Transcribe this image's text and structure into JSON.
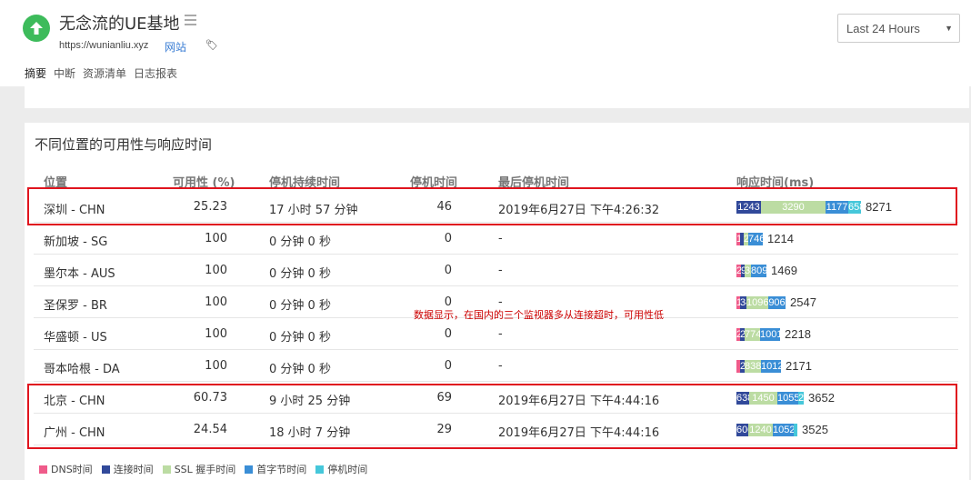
{
  "header": {
    "title": "无念流的UE基地",
    "url": "https://wunianliu.xyz",
    "type_label": "网站",
    "time_range": "Last 24 Hours"
  },
  "tabs": [
    {
      "label": "摘要",
      "active": true
    },
    {
      "label": "中断",
      "active": false
    },
    {
      "label": "资源清单",
      "active": false
    },
    {
      "label": "日志报表",
      "active": false
    }
  ],
  "section": {
    "title": "不同位置的可用性与响应时间",
    "columns": [
      "位置",
      "可用性 (%)",
      "停机持续时间",
      "停机时间",
      "最后停机时间",
      "响应时间(ms)"
    ]
  },
  "colors": {
    "dns": "#ef5b8a",
    "connect": "#31499a",
    "ssl": "#bcdca3",
    "first_byte": "#3a8ed6",
    "down": "#45c7da"
  },
  "rows": [
    {
      "location": "深圳 - CHN",
      "availability": "25.23",
      "downtime_duration": "17 小时 57 分钟",
      "downtime_count": "46",
      "last_down": "2019年6月27日 下午4:26:32",
      "segments": [
        {
          "type": "connect",
          "value": 1243,
          "label": "1243"
        },
        {
          "type": "ssl",
          "value": 3290,
          "label": "3290"
        },
        {
          "type": "first_byte",
          "value": 1177,
          "label": "1177"
        },
        {
          "type": "down",
          "value": 658,
          "label": "658"
        }
      ],
      "total": "8271"
    },
    {
      "location": "新加坡 - SG",
      "availability": "100",
      "downtime_duration": "0 分钟 0 秒",
      "downtime_count": "0",
      "last_down": "-",
      "segments": [
        {
          "type": "dns",
          "value": 162,
          "label": "162"
        },
        {
          "type": "connect",
          "value": 40,
          "label": ""
        },
        {
          "type": "ssl",
          "value": 247,
          "label": "247"
        },
        {
          "type": "first_byte",
          "value": 746,
          "label": "746"
        }
      ],
      "total": "1214"
    },
    {
      "location": "墨尔本 - AUS",
      "availability": "100",
      "downtime_duration": "0 分钟 0 秒",
      "downtime_count": "0",
      "last_down": "-",
      "segments": [
        {
          "type": "dns",
          "value": 240,
          "label": "240"
        },
        {
          "type": "connect",
          "value": 91,
          "label": "91"
        },
        {
          "type": "ssl",
          "value": 327,
          "label": "327"
        },
        {
          "type": "first_byte",
          "value": 809,
          "label": "809"
        }
      ],
      "total": "1469"
    },
    {
      "location": "圣保罗 - BR",
      "availability": "100",
      "downtime_duration": "0 分钟 0 秒",
      "downtime_count": "0",
      "last_down": "-",
      "segments": [
        {
          "type": "dns",
          "value": 197,
          "label": "197"
        },
        {
          "type": "connect",
          "value": 348,
          "label": "348"
        },
        {
          "type": "ssl",
          "value": 1096,
          "label": "1096"
        },
        {
          "type": "first_byte",
          "value": 906,
          "label": "906"
        }
      ],
      "total": "2547"
    },
    {
      "location": "华盛顿 - US",
      "availability": "100",
      "downtime_duration": "0 分钟 0 秒",
      "downtime_count": "0",
      "last_down": "-",
      "segments": [
        {
          "type": "dns",
          "value": 200,
          "label": "200"
        },
        {
          "type": "connect",
          "value": 236,
          "label": "236"
        },
        {
          "type": "ssl",
          "value": 774,
          "label": "774"
        },
        {
          "type": "first_byte",
          "value": 1001,
          "label": "1001"
        }
      ],
      "total": "2218"
    },
    {
      "location": "哥本哈根 - DA",
      "availability": "100",
      "downtime_duration": "0 分钟 0 秒",
      "downtime_count": "0",
      "last_down": "-",
      "segments": [
        {
          "type": "dns",
          "value": 60,
          "label": ""
        },
        {
          "type": "connect",
          "value": 255,
          "label": "255"
        },
        {
          "type": "ssl",
          "value": 838,
          "label": "838"
        },
        {
          "type": "first_byte",
          "value": 1012,
          "label": "1012"
        }
      ],
      "total": "2171"
    },
    {
      "location": "北京 - CHN",
      "availability": "60.73",
      "downtime_duration": "9 小时 25 分钟",
      "downtime_count": "69",
      "last_down": "2019年6月27日 下午4:44:16",
      "segments": [
        {
          "type": "connect",
          "value": 638,
          "label": "638"
        },
        {
          "type": "ssl",
          "value": 1450,
          "label": "1450"
        },
        {
          "type": "first_byte",
          "value": 1055,
          "label": "1055"
        },
        {
          "type": "down",
          "value": 263,
          "label": "26"
        }
      ],
      "total": "3652"
    },
    {
      "location": "广州 - CHN",
      "availability": "24.54",
      "downtime_duration": "18 小时 7 分钟",
      "downtime_count": "29",
      "last_down": "2019年6月27日 下午4:44:16",
      "segments": [
        {
          "type": "connect",
          "value": 600,
          "label": "600"
        },
        {
          "type": "ssl",
          "value": 1240,
          "label": "1240"
        },
        {
          "type": "first_byte",
          "value": 1052,
          "label": "1052"
        },
        {
          "type": "down",
          "value": 120,
          "label": ""
        }
      ],
      "total": "3525"
    }
  ],
  "annotation": "数据显示，在国内的三个监视器多从连接超时，可用性低",
  "legend": [
    {
      "type": "dns",
      "label": "DNS时间"
    },
    {
      "type": "connect",
      "label": "连接时间"
    },
    {
      "type": "ssl",
      "label": "SSL 握手时间"
    },
    {
      "type": "first_byte",
      "label": "首字节时间"
    },
    {
      "type": "down",
      "label": "停机时间"
    }
  ]
}
